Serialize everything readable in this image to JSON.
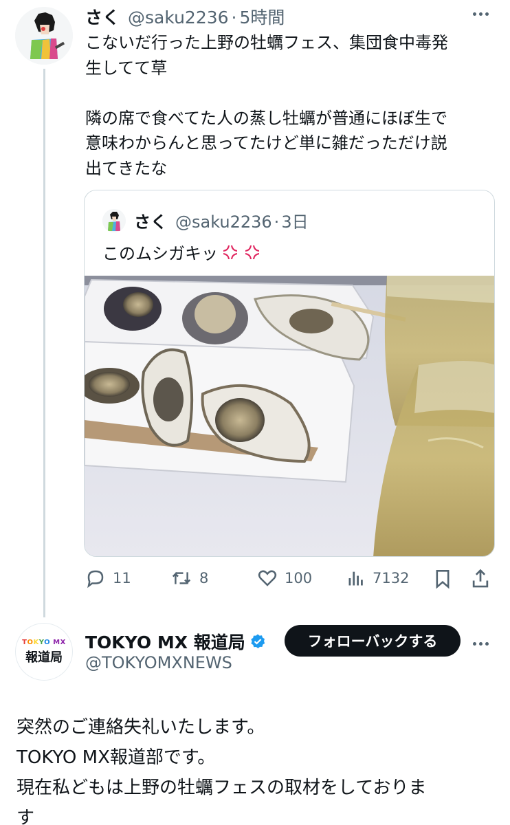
{
  "tweet1": {
    "name": "さく",
    "handle": "@saku2236",
    "separator": "·",
    "time": "5時間",
    "lines_a": [
      "こないだ行った上野の牡蠣フェス、集団食中毒発",
      "生してて草"
    ],
    "lines_b": [
      "隣の席で食べてた人の蒸し牡蠣が普通にほぼ生で",
      "意味わからんと思ってたけど単に雑だっただけ説",
      "出てきたな"
    ]
  },
  "quote": {
    "name": "さく",
    "handle": "@saku2236",
    "separator": "·",
    "time": "3日",
    "text": "このムシガキッ",
    "emoji": "anger-symbol-icon"
  },
  "actions": {
    "replies": "11",
    "retweets": "8",
    "likes": "100",
    "views": "7132"
  },
  "tweet2": {
    "avatar_top": "TOKYO MX",
    "avatar_bottom": "報道局",
    "name": "TOKYO MX 報道局",
    "handle": "@TOKYOMXNEWS",
    "follow_button": "フォローバックする",
    "lines": [
      "突然のご連絡失礼いたします。",
      "TOKYO MX報道部です。",
      "現在私どもは上野の牡蠣フェスの取材をしておりま",
      "す"
    ]
  },
  "colors": {
    "text": "#0f1419",
    "secondary": "#536471",
    "verified": "#1d9bf0",
    "border": "#cfd9de",
    "anger": "#e0245e"
  }
}
